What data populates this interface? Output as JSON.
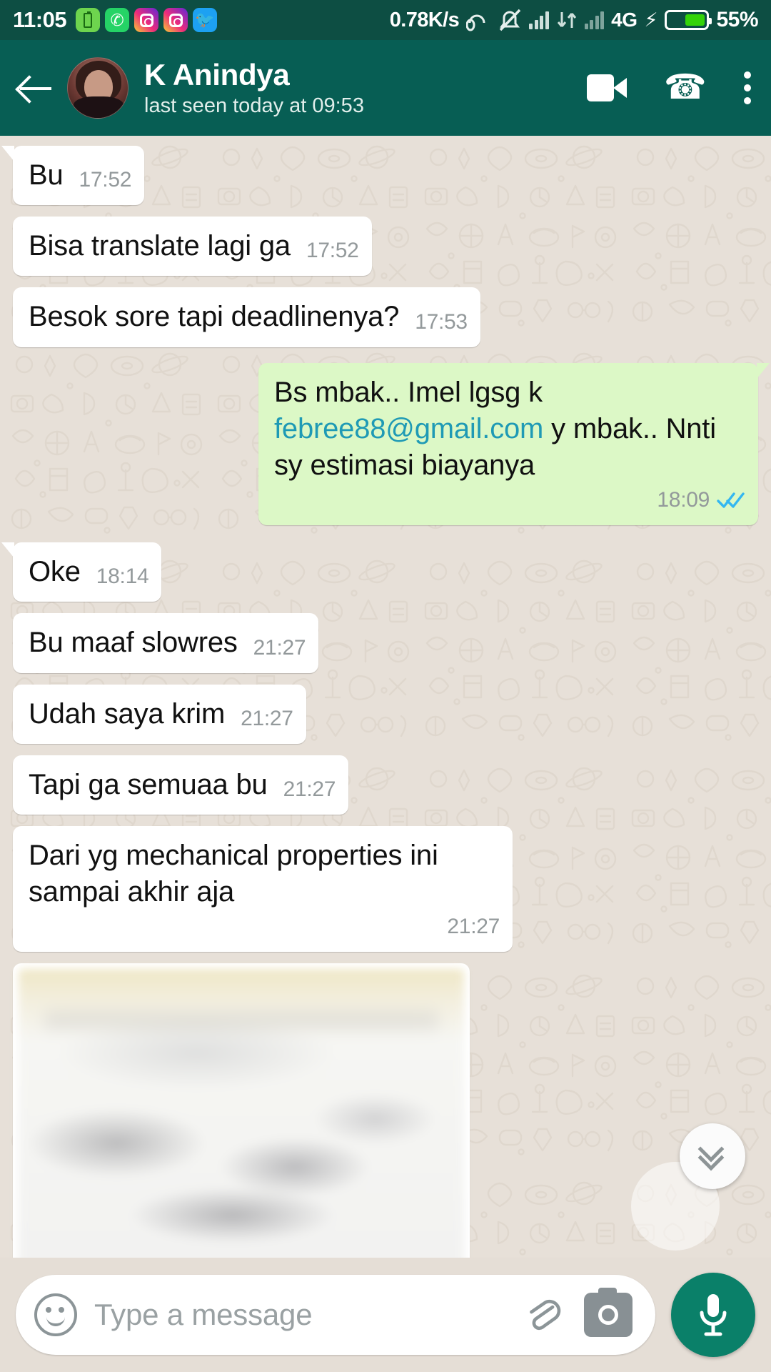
{
  "statusbar": {
    "clock": "11:05",
    "network_speed": "0.78K/s",
    "network_type": "4G",
    "battery_percent": "55%",
    "icons": [
      "battery-app-icon",
      "whatsapp-icon",
      "instagram-icon",
      "instagram-icon",
      "twitter-icon",
      "headphone-icon",
      "mute-icon",
      "signal-bars-icon",
      "data-transfer-icon",
      "signal-bars-icon",
      "charging-bolt-icon",
      "battery-icon"
    ]
  },
  "appbar": {
    "back_icon": "back-arrow-icon",
    "contact_name": "K Anindya",
    "status_text": "last seen today at 09:53",
    "video_call_icon": "video-camera-icon",
    "voice_call_icon": "phone-icon",
    "menu_icon": "more-options-icon"
  },
  "messages": [
    {
      "id": "m1",
      "direction": "in",
      "tail": true,
      "text": "Bu",
      "time": "17:52",
      "layout": "inline"
    },
    {
      "id": "m2",
      "direction": "in",
      "tail": false,
      "text": "Bisa translate lagi ga",
      "time": "17:52",
      "layout": "inline"
    },
    {
      "id": "m3",
      "direction": "in",
      "tail": false,
      "text": "Besok sore tapi deadlinenya?",
      "time": "17:53",
      "layout": "inline"
    },
    {
      "id": "m4",
      "direction": "out",
      "tail": true,
      "text_before": "Bs mbak.. Imel lgsg k ",
      "link": "febree88@gmail.com",
      "text_after": " y mbak.. Nnti sy estimasi biayanya",
      "time": "18:09",
      "status": "read",
      "layout": "block"
    },
    {
      "id": "m5",
      "direction": "in",
      "tail": true,
      "text": "Oke",
      "time": "18:14",
      "layout": "inline"
    },
    {
      "id": "m6",
      "direction": "in",
      "tail": false,
      "text": "Bu maaf slowres",
      "time": "21:27",
      "layout": "inline"
    },
    {
      "id": "m7",
      "direction": "in",
      "tail": false,
      "text": "Udah saya krim",
      "time": "21:27",
      "layout": "inline"
    },
    {
      "id": "m8",
      "direction": "in",
      "tail": false,
      "text": "Tapi ga semuaa bu",
      "time": "21:27",
      "layout": "inline"
    },
    {
      "id": "m9",
      "direction": "in",
      "tail": false,
      "text": "Dari yg mechanical properties ini sampai akhir aja",
      "time": "21:27",
      "layout": "block"
    },
    {
      "id": "m10",
      "direction": "in",
      "tail": false,
      "type": "image",
      "caption": ""
    }
  ],
  "scroll_button": {
    "icon": "double-chevron-down-icon"
  },
  "composer": {
    "emoji_icon": "emoji-smiley-icon",
    "placeholder": "Type a message",
    "value": "",
    "attach_icon": "paperclip-icon",
    "camera_icon": "camera-icon",
    "mic_icon": "microphone-icon"
  },
  "colors": {
    "statusbar_bg": "#0d4e43",
    "appbar_bg": "#075e54",
    "chat_bg": "#e7e0d8",
    "incoming_bubble": "#ffffff",
    "outgoing_bubble": "#dcf8c6",
    "link": "#1f9ab5",
    "timestamp": "#93999b",
    "tick_read": "#34b7f1",
    "mic_fab": "#0a8069"
  }
}
